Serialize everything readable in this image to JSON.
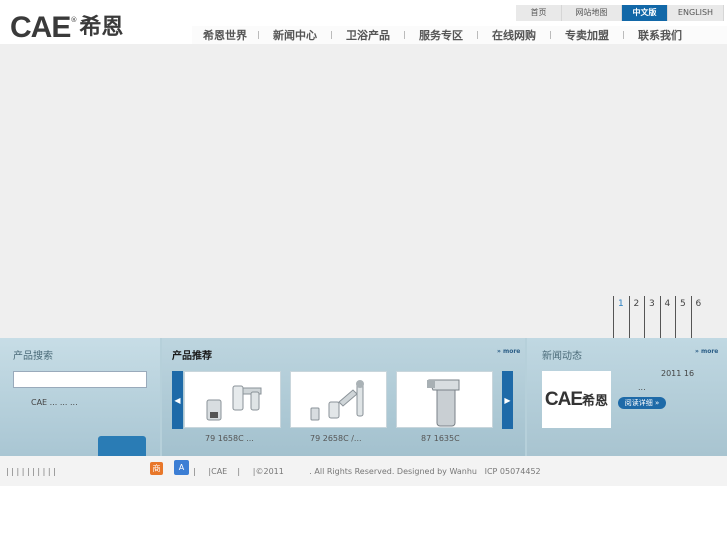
{
  "header": {
    "logo_text": "CAE",
    "logo_reg": "®",
    "logo_cn": "希恩"
  },
  "top_nav": [
    {
      "label": "首页",
      "active": false
    },
    {
      "label": "网站地图",
      "active": false
    },
    {
      "label": "中文版",
      "active": true
    },
    {
      "label": "ENGLISH",
      "active": false
    }
  ],
  "main_nav": [
    "希恩世界",
    "新闻中心",
    "卫浴产品",
    "服务专区",
    "在线网购",
    "专卖加盟",
    "联系我们"
  ],
  "slider": {
    "numbers": [
      "1",
      "2",
      "3",
      "4",
      "5",
      "6"
    ],
    "active": "1"
  },
  "panel_left": {
    "title": "产品搜索",
    "text": "CAE ...      ...      ..."
  },
  "panel_middle": {
    "title": "产品推荐",
    "more": "» more",
    "prev": "◀",
    "next": "▶",
    "products": [
      {
        "caption": "79 1658C      ..."
      },
      {
        "caption": "79 2658C      /..."
      },
      {
        "caption": "87 1635C"
      }
    ]
  },
  "panel_right": {
    "title": "新闻动态",
    "more": "» more",
    "logo_text": "CAE",
    "logo_cn": "希恩",
    "date": "2011  16",
    "dots": "...",
    "read_more": "阅读详细 »"
  },
  "footer": {
    "bars": "|     |     |     |     |     |     |     |     |     |",
    "icon1": "商",
    "icon2": "A",
    "text": "|     |CAE    |     |©2011          . All Rights Reserved. Designed by Wanhu   ICP 05074452"
  },
  "colors": {
    "accent": "#1268a8",
    "panel_bg": "#b6d0da",
    "hero_bg": "#efefef"
  }
}
